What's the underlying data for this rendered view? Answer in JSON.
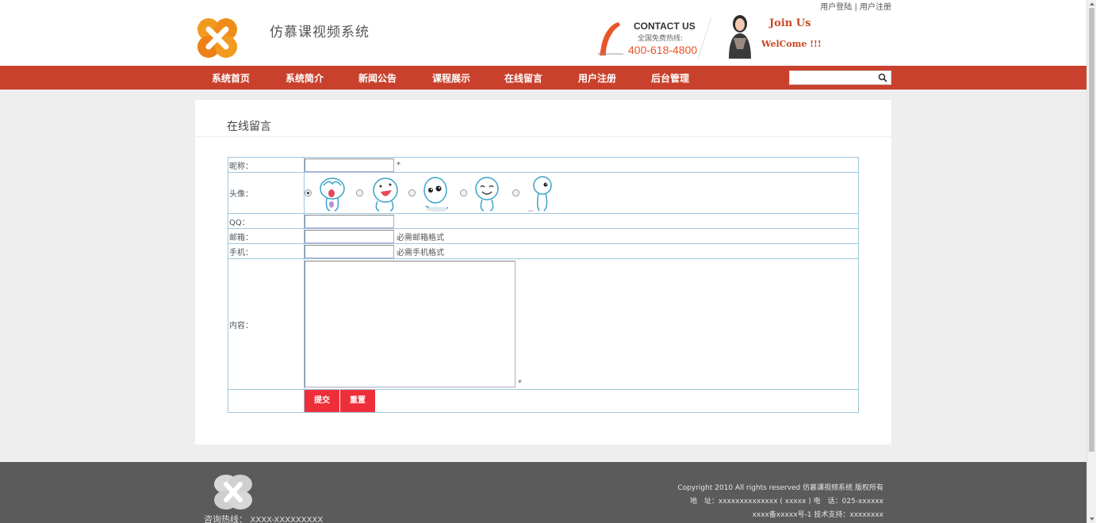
{
  "toplinks": {
    "login": "用户登陆",
    "sep": " | ",
    "register": "用户注册"
  },
  "site": {
    "title": "仿慕课视频系统"
  },
  "contact": {
    "title": "CONTACT US",
    "subtitle": "全国免费热线:",
    "number": "400-618-4800"
  },
  "promo": {
    "join": "Join Us",
    "welcome": "WelCome !!!"
  },
  "nav": {
    "items": [
      "系统首页",
      "系统简介",
      "新闻公告",
      "课程展示",
      "在线留言",
      "用户注册",
      "后台管理"
    ],
    "search_placeholder": ""
  },
  "page": {
    "title": "在线留言"
  },
  "form": {
    "nickname_label": "昵称：",
    "required_mark": "*",
    "avatar_label": "头像：",
    "qq_label": "QQ：",
    "email_label": "邮箱：",
    "email_hint": "必需邮箱格式",
    "phone_label": "手机：",
    "phone_hint": "必需手机格式",
    "content_label": "内容：",
    "submit": "提交",
    "reset": "重置"
  },
  "footer": {
    "hotline_label": "咨询热线：",
    "hotline_number": "XXXX-XXXXXXXXX",
    "copyright": "Copyright 2010 All rights reserved 仿慕课视频系统 版权所有",
    "address": "地　址：xxxxxxxxxxxxxx ( xxxxx ) 电　话：025-xxxxxx",
    "icp": "xxxx备xxxxx号-1 技术支持：xxxxxxxx"
  },
  "colors": {
    "nav_bg": "#c9412c",
    "button": "#ee2f3a",
    "footer_bg": "#5b5b5b",
    "accent": "#e8552a"
  }
}
